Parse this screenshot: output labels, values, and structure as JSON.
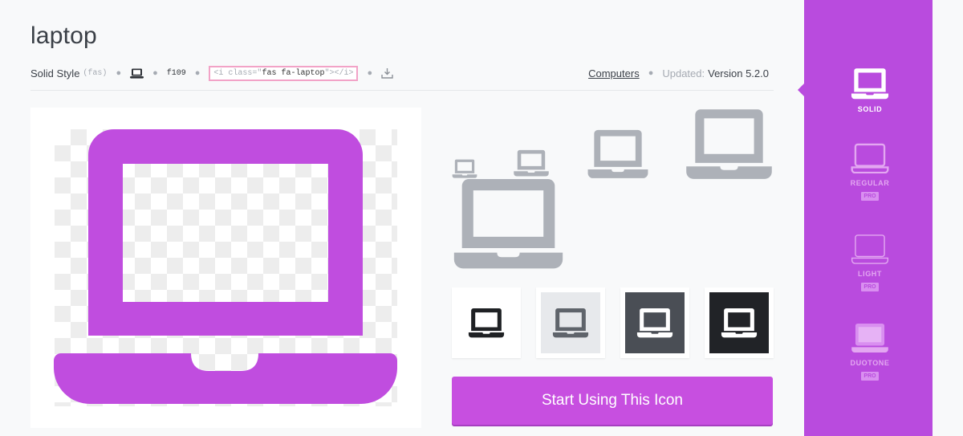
{
  "icon": {
    "name": "laptop",
    "style_label": "Solid Style",
    "style_prefix": "(fas)",
    "unicode": "f109",
    "snippet_open": "<i class=\"",
    "snippet_class": "fas fa-laptop",
    "snippet_close": "\"></i>",
    "category": "Computers",
    "updated_label": "Updated:",
    "version": "Version 5.2.0"
  },
  "colors": {
    "accent": "#c74fe0",
    "sidebar": "#b94bde",
    "icon_gray": "#adb1b8",
    "swatch_bgs": [
      "#ffffff",
      "#e7e9ec",
      "#4a4e55",
      "#212327"
    ],
    "swatch_icons": [
      "#1f2124",
      "#5f646b",
      "#ffffff",
      "#ffffff"
    ]
  },
  "cta": {
    "label": "Start Using This Icon"
  },
  "styles": [
    {
      "label": "SOLID",
      "active": true,
      "pro": ""
    },
    {
      "label": "REGULAR",
      "active": false,
      "pro": "PRO"
    },
    {
      "label": "LIGHT",
      "active": false,
      "pro": "PRO"
    },
    {
      "label": "DUOTONE",
      "active": false,
      "pro": "PRO"
    }
  ]
}
